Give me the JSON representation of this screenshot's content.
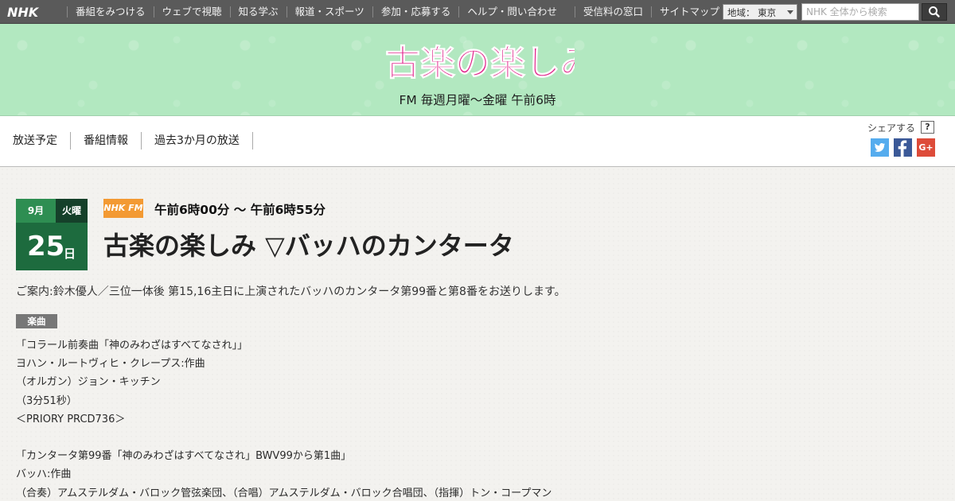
{
  "topbar": {
    "logo": "NHK",
    "nav": [
      "番組をみつける",
      "ウェブで視聴",
      "知る学ぶ",
      "報道・スポーツ",
      "参加・応募する",
      "ヘルプ・問い合わせ"
    ],
    "nav_right": [
      "受信料の窓口",
      "サイトマップ"
    ],
    "region": "地域： 東京",
    "search_placeholder": "NHK 全体から検索"
  },
  "banner": {
    "title": "古楽の楽しみ",
    "subtitle": "FM 毎週月曜～金曜 午前6時"
  },
  "subnav": {
    "links": [
      "放送予定",
      "番組情報",
      "過去3か月の放送"
    ],
    "share_label": "シェアする",
    "share_help": "?",
    "share_buttons": [
      {
        "name": "twitter",
        "color": "#55acee"
      },
      {
        "name": "facebook",
        "color": "#3b5998"
      },
      {
        "name": "google-plus",
        "color": "#dd4b39",
        "label": "G+"
      }
    ]
  },
  "episode": {
    "month": "9月",
    "weekday": "火曜",
    "day": "25",
    "day_unit": "日",
    "channel": "NHK FM",
    "airtime": "午前6時00分 ～ 午前6時55分",
    "title": "古楽の楽しみ ▽バッハのカンタータ",
    "guide": "ご案内:鈴木優人／三位一体後 第15,16主日に上演されたバッハのカンタータ第99番と第8番をお送りします。",
    "music_label": "楽曲",
    "tracks": [
      "「コラール前奏曲「神のみわざはすべてなされ」」",
      "ヨハン・ルートヴィヒ・クレープス:作曲",
      "（オルガン）ジョン・キッチン",
      "（3分51秒）",
      "＜PRIORY PRCD736＞",
      "",
      "「カンタータ第99番「神のみわざはすべてなされ」BWV99から第1曲」",
      "バッハ:作曲",
      "（合奏）アムステルダム・バロック管弦楽団、（合唱）アムステルダム・バロック合唱団、（指揮）トン・コープマン"
    ]
  },
  "colors": {
    "topbar": "#5a5a5a",
    "banner": "#b2e8c0",
    "title_pink": "#e0218a",
    "date_green": "#1d6b3e",
    "fm_orange": "#f39a33"
  }
}
